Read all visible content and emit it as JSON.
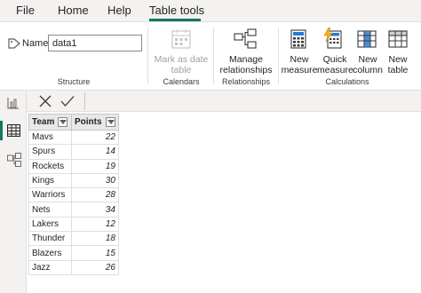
{
  "menu": {
    "items": [
      {
        "label": "File"
      },
      {
        "label": "Home"
      },
      {
        "label": "Help"
      },
      {
        "label": "Table tools"
      }
    ],
    "active_index": 3
  },
  "ribbon": {
    "structure": {
      "name_label": "Name",
      "name_value": "data1",
      "group_label": "Structure"
    },
    "calendars": {
      "mark_as_date_line1": "Mark as date",
      "mark_as_date_line2": "table",
      "group_label": "Calendars"
    },
    "relationships": {
      "manage_line1": "Manage",
      "manage_line2": "relationships",
      "group_label": "Relationships"
    },
    "calculations": {
      "new_measure_line1": "New",
      "new_measure_line2": "measure",
      "quick_measure_line1": "Quick",
      "quick_measure_line2": "measure",
      "new_column_line1": "New",
      "new_column_line2": "column",
      "new_table_line1": "New",
      "new_table_line2": "table",
      "group_label": "Calculations"
    }
  },
  "rail": {
    "icons": [
      "report-view-icon",
      "table-view-icon",
      "model-view-icon"
    ],
    "active": "table-view-icon"
  },
  "formula_bar": {
    "icons": [
      "cancel-icon",
      "commit-icon"
    ]
  },
  "table": {
    "columns": [
      "Team",
      "Points"
    ],
    "rows": [
      [
        "Mavs",
        "22"
      ],
      [
        "Spurs",
        "14"
      ],
      [
        "Rockets",
        "19"
      ],
      [
        "Kings",
        "30"
      ],
      [
        "Warriors",
        "28"
      ],
      [
        "Nets",
        "34"
      ],
      [
        "Lakers",
        "12"
      ],
      [
        "Thunder",
        "18"
      ],
      [
        "Blazers",
        "15"
      ],
      [
        "Jazz",
        "26"
      ]
    ]
  },
  "colors": {
    "accent": "#117865",
    "ribbon_bg": "#ffffff",
    "chrome_bg": "#f3f2f1"
  }
}
